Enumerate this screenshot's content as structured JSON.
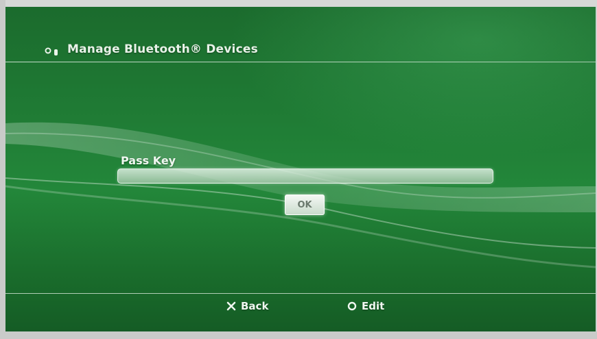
{
  "header": {
    "title": "Manage Bluetooth® Devices",
    "icon": "bluetooth-devices-icon"
  },
  "dialog": {
    "field_label": "Pass Key",
    "field_value": "",
    "ok_label": "OK"
  },
  "footer": {
    "back": {
      "icon": "cross-icon",
      "label": "Back"
    },
    "edit": {
      "icon": "circle-icon",
      "label": "Edit"
    }
  },
  "colors": {
    "background": "#1f7a34",
    "text": "#f0f7f0"
  }
}
